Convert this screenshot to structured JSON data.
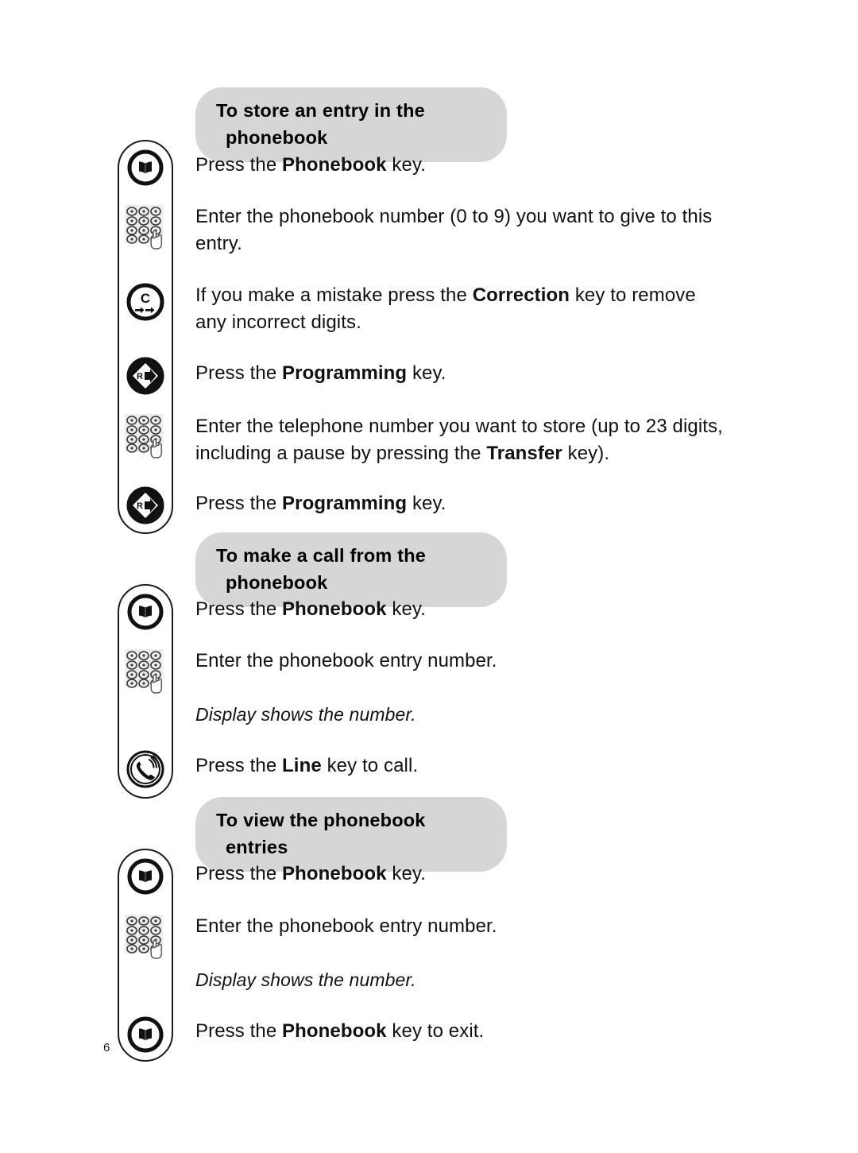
{
  "page": {
    "number": "6"
  },
  "sections": [
    {
      "heading_line1": "To store an entry in the",
      "heading_line2": "phonebook",
      "steps": [
        {
          "icon": "phonebook-key-icon",
          "text_html": "Press the <b>Phonebook</b> key."
        },
        {
          "icon": "keypad-icon",
          "text_html": "Enter the phonebook number (0 to 9) you want to give to this entry."
        },
        {
          "icon": "correction-key-icon",
          "text_html": "If you make a mistake press the <b>Correction</b> key to remove any incorrect digits."
        },
        {
          "icon": "programming-key-icon",
          "text_html": "Press the <b>Programming</b> key."
        },
        {
          "icon": "keypad-icon",
          "text_html": "Enter the telephone number you want to store (up to 23 digits, including a pause by pressing the <b>Transfer</b> key)."
        },
        {
          "icon": "programming-key-icon",
          "text_html": "Press the <b>Programming</b> key."
        }
      ]
    },
    {
      "heading_line1": "To make a call from the",
      "heading_line2": "phonebook",
      "steps": [
        {
          "icon": "phonebook-key-icon",
          "text_html": "Press the <b>Phonebook</b> key."
        },
        {
          "icon": "keypad-icon",
          "text_html": "Enter the phonebook entry number."
        },
        {
          "icon": "none",
          "text_html": "Display shows the number.",
          "italic": true
        },
        {
          "icon": "line-key-icon",
          "text_html": "Press the <b>Line</b> key to call."
        }
      ]
    },
    {
      "heading_line1": "To view the phonebook",
      "heading_line2": "entries",
      "steps": [
        {
          "icon": "phonebook-key-icon",
          "text_html": "Press the <b>Phonebook</b> key."
        },
        {
          "icon": "keypad-icon",
          "text_html": "Enter the phonebook entry number."
        },
        {
          "icon": "none",
          "text_html": "Display shows the number.",
          "italic": true
        },
        {
          "icon": "phonebook-key-icon",
          "text_html": "Press the <b>Phonebook</b> key to exit."
        }
      ]
    }
  ],
  "colors": {
    "pill_background": "#d6d6d6",
    "text": "#111111",
    "outline": "#1a1a1a",
    "keypad_background": "#ededed"
  }
}
